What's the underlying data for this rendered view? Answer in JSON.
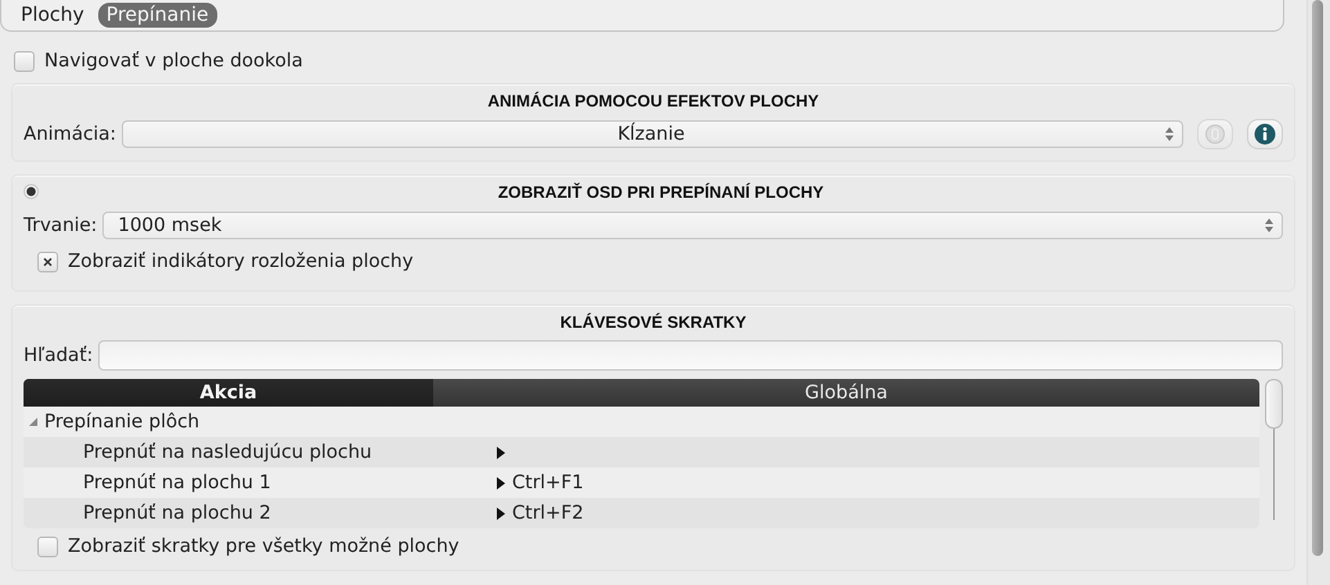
{
  "tabs": [
    {
      "label": "Plochy",
      "selected": false
    },
    {
      "label": "Prepínanie",
      "selected": true
    }
  ],
  "wrap_navigation": {
    "label": "Navigovať v ploche dookola",
    "checked": false
  },
  "animation_group": {
    "title": "ANIMÁCIA POMOCOU EFEKTOV PLOCHY",
    "label": "Animácia:",
    "value": "Kĺzanie",
    "buttons": [
      {
        "kind": "configure",
        "disabled": true
      },
      {
        "kind": "info",
        "disabled": false
      }
    ]
  },
  "osd_group": {
    "title": "ZOBRAZIŤ OSD PRI PREPÍNANÍ PLOCHY",
    "enabled": true,
    "duration_label": "Trvanie:",
    "duration_value": "1000 msek",
    "layout_indicators": {
      "label": "Zobraziť indikátory rozloženia plochy",
      "checked": true
    }
  },
  "shortcuts_group": {
    "title": "KLÁVESOVÉ SKRATKY",
    "search_label": "Hľadať:",
    "columns": [
      {
        "label": "Akcia",
        "selected": true
      },
      {
        "label": "Globálna",
        "selected": false
      }
    ],
    "tree": [
      {
        "label": "Prepínanie plôch",
        "expanded": true,
        "children": [
          {
            "label": "Prepnúť na nasledujúcu plochu"
          },
          {
            "label": "Prepnúť na plochu 1",
            "shortcut": "Ctrl+F1"
          },
          {
            "label": "Prepnúť na plochu 2",
            "shortcut": "Ctrl+F2"
          }
        ]
      }
    ],
    "show_all": {
      "label": "Zobraziť skratky pre všetky možné plochy",
      "checked": false
    }
  }
}
